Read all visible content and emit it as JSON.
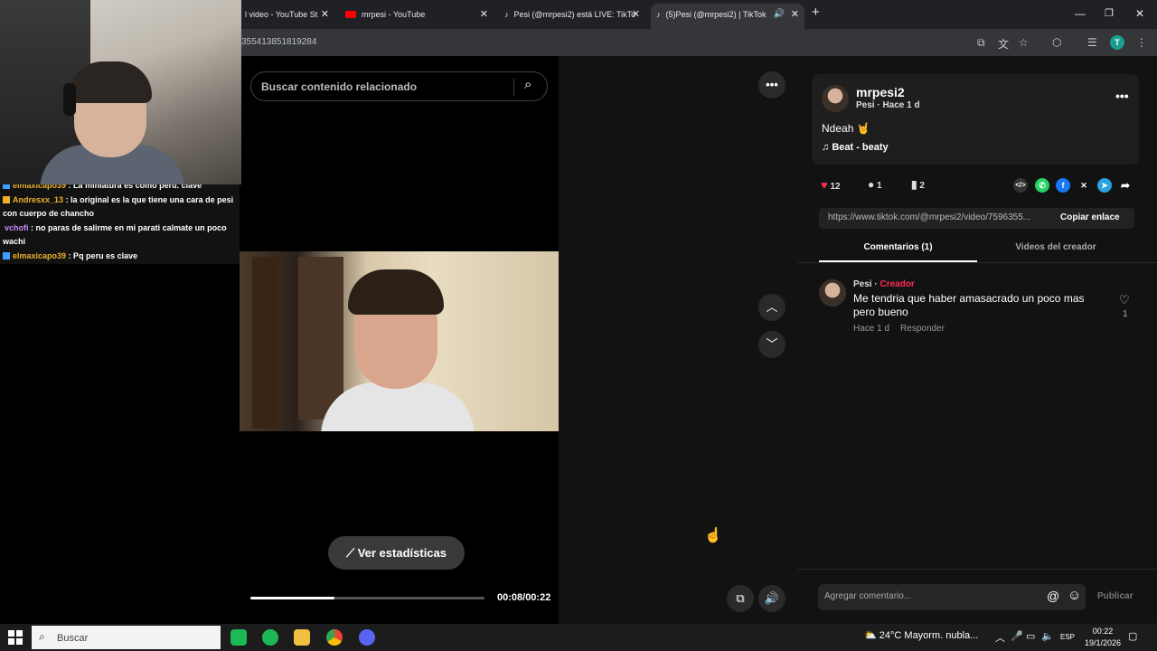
{
  "browser": {
    "tabs": [
      {
        "title": "l video - YouTube St",
        "icon": "youtube-studio-icon"
      },
      {
        "title": "mrpesi - YouTube",
        "icon": "youtube-icon"
      },
      {
        "title": "Pesi (@mrpesi2) está LIVE: TikTo",
        "icon": "tiktok-icon"
      },
      {
        "title": "(5)Pesi (@mrpesi2) | TikTok",
        "icon": "tiktok-icon"
      }
    ],
    "url_fragment": "355413851819284",
    "profile_initial": "T"
  },
  "stream_chat": [
    {
      "user": "elmaxicapo39",
      "text": ": La miniatura es como peru. clave",
      "color": "#f0b02e"
    },
    {
      "user": "Andresxx_13",
      "text": ": la original es la que tiene una cara de pesi con cuerpo de chancho",
      "color": "#f0b02e"
    },
    {
      "user": "vchofi",
      "text": ": no paras de salirme en mi parati calmate un poco wachi",
      "color": "#c58cff"
    },
    {
      "user": "elmaxicapo39",
      "text": ": Pq peru es clave",
      "color": "#f0b02e"
    }
  ],
  "search": {
    "placeholder": "Buscar contenido relacionado"
  },
  "player": {
    "stats_label": "Ver estadísticas",
    "time": "00:08/00:22",
    "progress": 0.36
  },
  "post": {
    "author": "mrpesi2",
    "subtitle": "Pesi · Hace 1 d",
    "caption": "Ndeah 🤘",
    "music": "Beat - beaty",
    "likes": "12",
    "comments": "1",
    "saves": "2",
    "link": "https://www.tiktok.com/@mrpesi2/video/7596355...",
    "copy_label": "Copiar enlace"
  },
  "panel_tabs": {
    "comments": "Comentarios (1)",
    "creator_videos": "Videos del creador"
  },
  "comment": {
    "author": "Pesi · ",
    "badge": "Creador",
    "text": "Me tendria que haber amasacrado un poco mas pero bueno",
    "time": "Hace 1 d",
    "reply": "Responder",
    "likes": "1"
  },
  "composer": {
    "placeholder": "Agregar comentario...",
    "publish": "Publicar"
  },
  "taskbar": {
    "search": "Buscar",
    "weather": "24°C  Mayorm. nubla...",
    "lang": "ESP",
    "time": "00:22",
    "date": "19/1/2026"
  },
  "colors": {
    "accent": "#fe2c55",
    "like": "#fe2c55",
    "whatsapp": "#25d366",
    "facebook": "#1877f2",
    "telegram": "#2aa2e0"
  }
}
